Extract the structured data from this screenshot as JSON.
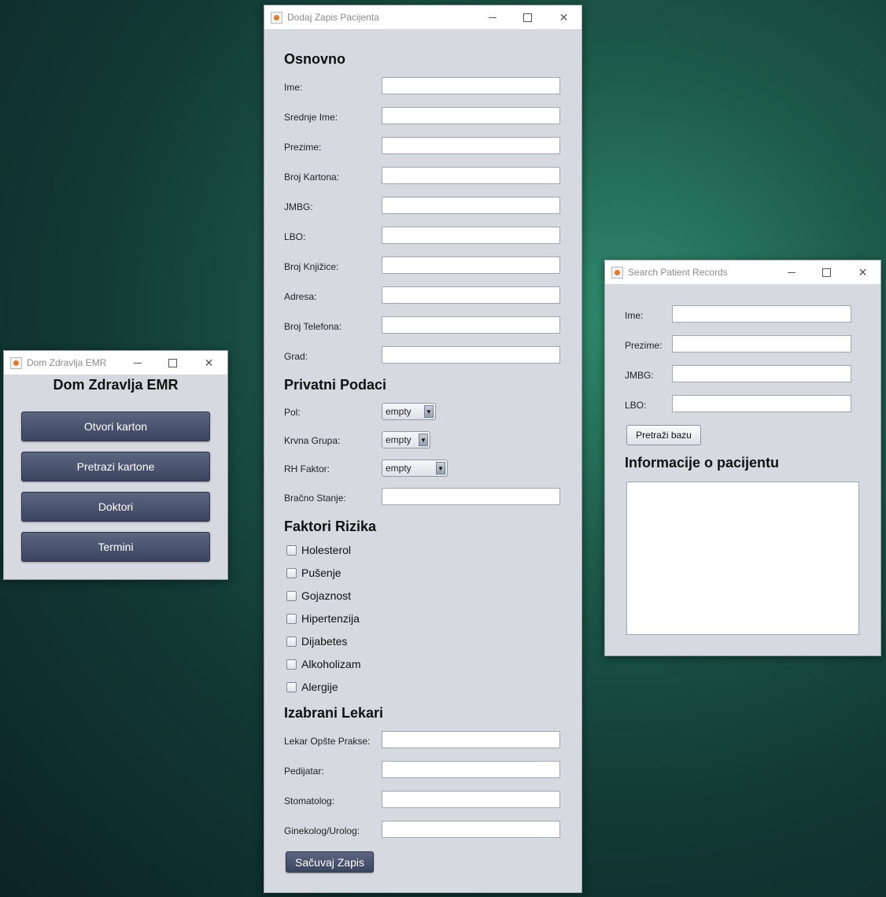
{
  "main_menu": {
    "title": "Dom Zdravlja EMR",
    "heading": "Dom Zdravlja EMR",
    "buttons": [
      "Otvori karton",
      "Pretrazi kartone",
      "Doktori",
      "Termini"
    ]
  },
  "add_record": {
    "title": "Dodaj Zapis Pacijenta",
    "section_basic": "Osnovno",
    "fields_basic": [
      "Ime:",
      "Srednje Ime:",
      "Prezime:",
      "Broj Kartona:",
      "JMBG:",
      "LBO:",
      "Broj Knjižice:",
      "Adresa:",
      "Broj Telefona:",
      "Grad:"
    ],
    "section_private": "Privatni Podaci",
    "pol_label": "Pol:",
    "pol_value": "empty",
    "krvna_label": "Krvna Grupa:",
    "krvna_value": "empty",
    "rh_label": "RH Faktor:",
    "rh_value": "empty",
    "bracno_label": "Bračno Stanje:",
    "section_risk": "Faktori Rizika",
    "risk_factors": [
      "Holesterol",
      "Pušenje",
      "Gojaznost",
      "Hipertenzija",
      "Dijabetes",
      "Alkoholizam",
      "Alergije"
    ],
    "section_doctors": "Izabrani Lekari",
    "fields_doctors": [
      "Lekar Opšte Prakse:",
      "Pedijatar:",
      "Stomatolog:",
      "Ginekolog/Urolog:"
    ],
    "save_label": "Sačuvaj Zapis"
  },
  "search": {
    "title": "Search Patient Records",
    "fields": [
      "Ime:",
      "Prezime:",
      "JMBG:",
      "LBO:"
    ],
    "search_button": "Pretraži bazu",
    "info_heading": "Informacije o pacijentu"
  },
  "colors": {
    "window_bg": "#d6d9e0",
    "dark_button": "#4a5470"
  }
}
